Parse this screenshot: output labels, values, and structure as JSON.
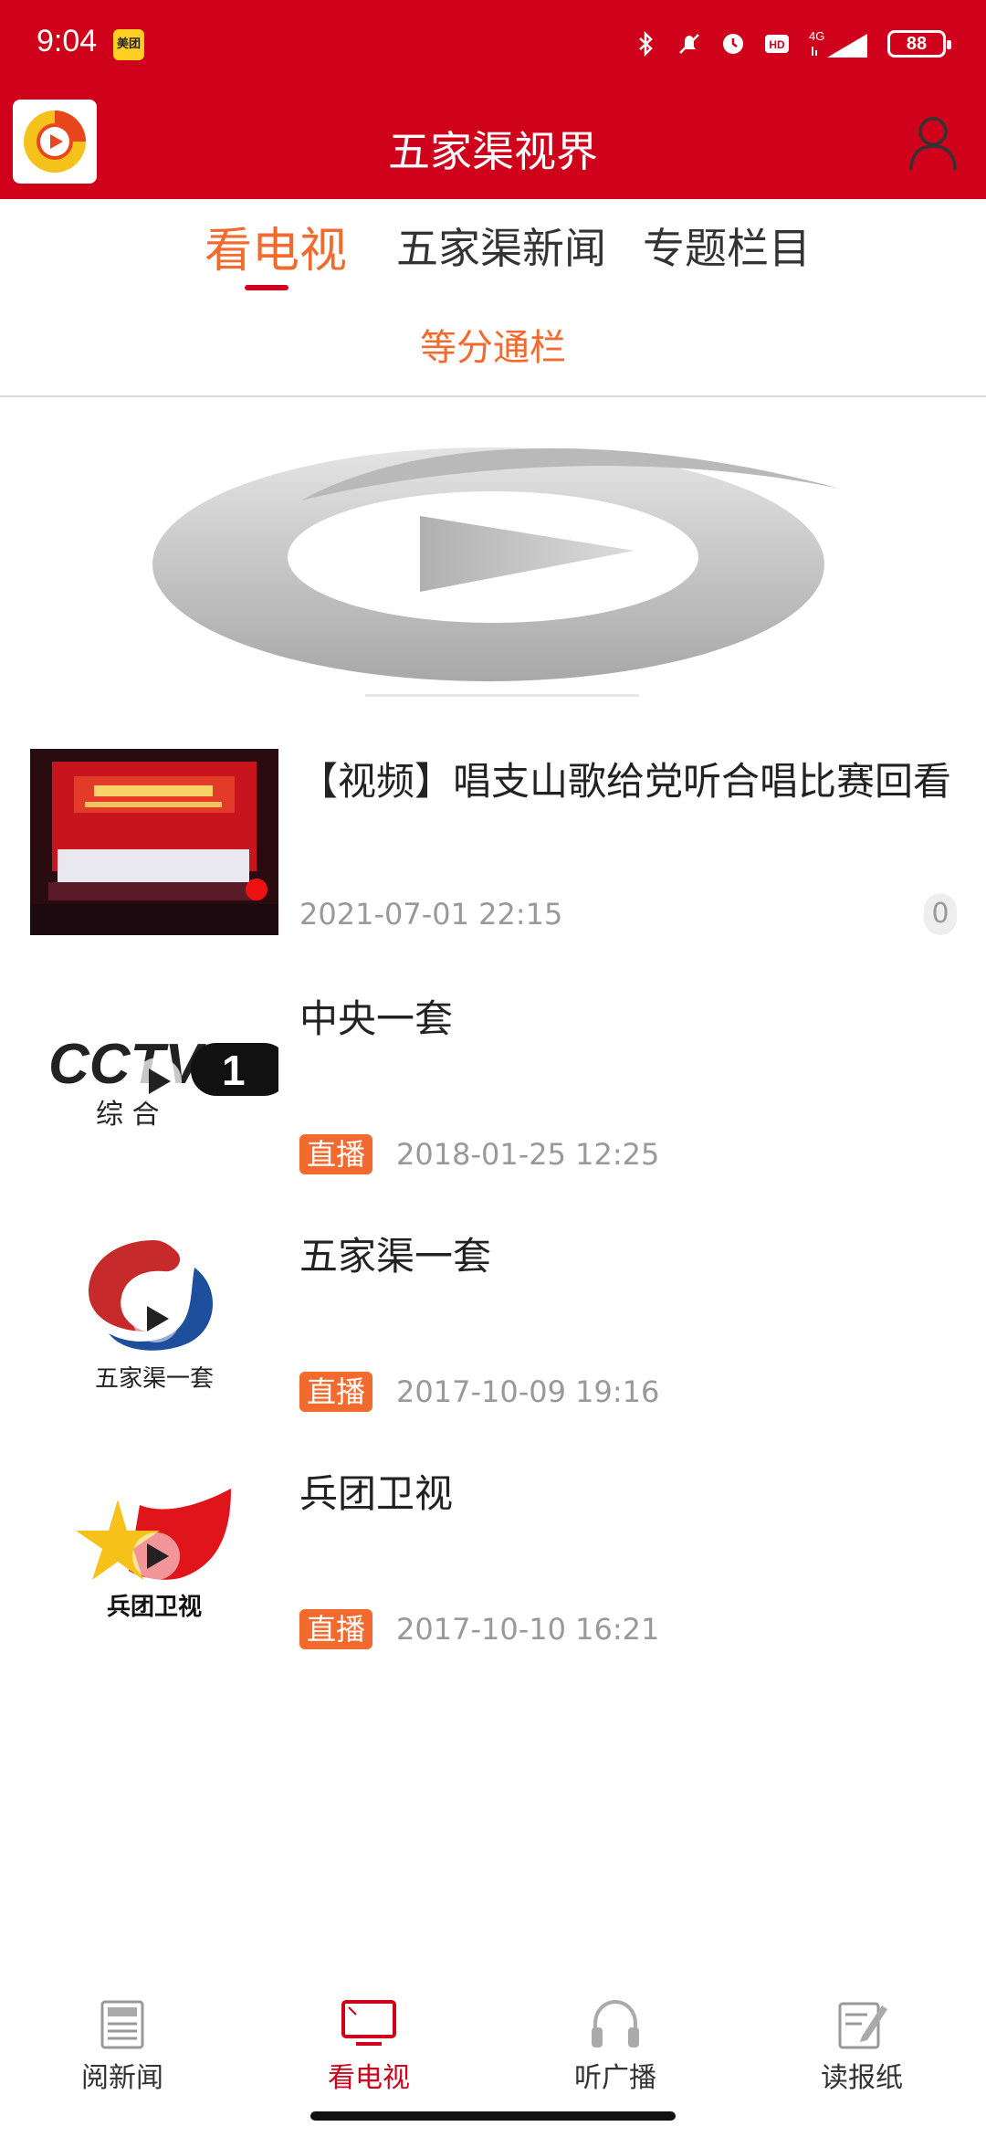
{
  "status_bar": {
    "time": "9:04",
    "notification_app": "美团",
    "network": "4G",
    "battery": "88"
  },
  "header": {
    "title": "五家渠视界",
    "logo_icon": "app-logo-icon",
    "user_icon": "user-icon"
  },
  "tabs": [
    {
      "label": "看电视",
      "active": true
    },
    {
      "label": "五家渠新闻",
      "active": false
    },
    {
      "label": "专题栏目",
      "active": false
    }
  ],
  "subtab": {
    "label": "等分通栏"
  },
  "list": [
    {
      "title": "【视频】唱支山歌给党听合唱比赛回看",
      "time": "2021-07-01 22:15",
      "count": "0",
      "badge": ""
    },
    {
      "title": "中央一套",
      "badge": "直播",
      "time": "2018-01-25 12:25",
      "logo_text": "综 合",
      "logo_number": "1"
    },
    {
      "title": "五家渠一套",
      "badge": "直播",
      "time": "2017-10-09 19:16",
      "logo_text": "五家渠一套"
    },
    {
      "title": "兵团卫视",
      "badge": "直播",
      "time": "2017-10-10 16:21",
      "logo_text": "兵团卫视"
    }
  ],
  "bottom_nav": [
    {
      "label": "阅新闻",
      "icon": "newspaper-icon",
      "active": false
    },
    {
      "label": "看电视",
      "icon": "tv-icon",
      "active": true
    },
    {
      "label": "听广播",
      "icon": "headphones-icon",
      "active": false
    },
    {
      "label": "读报纸",
      "icon": "paper-edit-icon",
      "active": false
    }
  ],
  "colors": {
    "brand_red": "#d0021b",
    "accent_orange": "#f26a2e"
  }
}
